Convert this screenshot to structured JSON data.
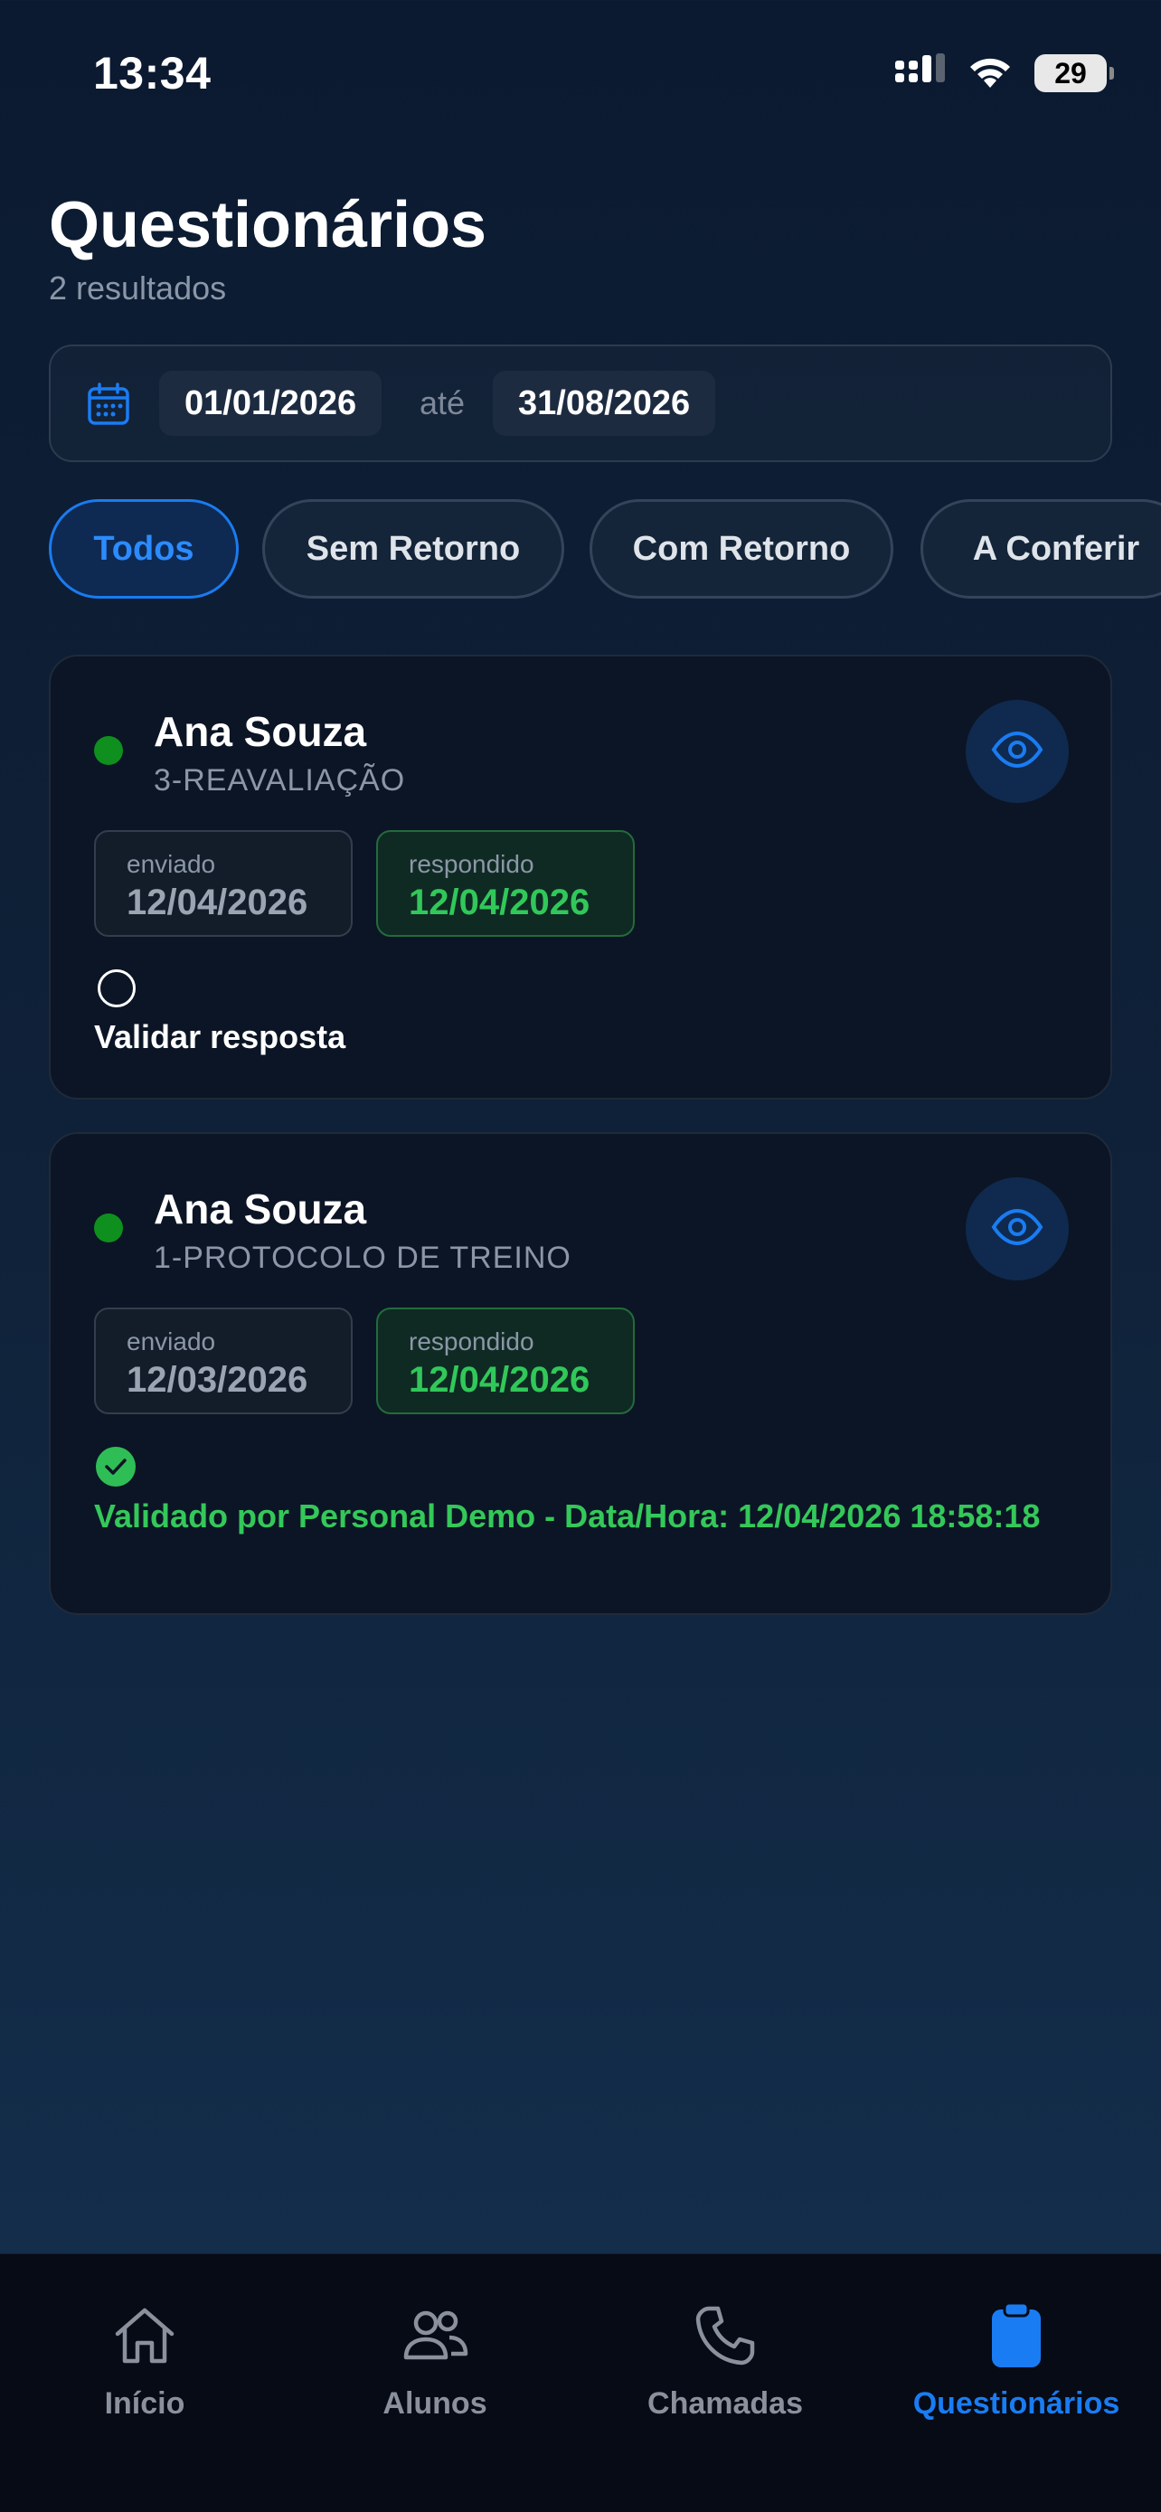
{
  "status_bar": {
    "time": "13:34",
    "battery": "29"
  },
  "header": {
    "title": "Questionários",
    "subtitle": "2 resultados"
  },
  "date_filter": {
    "from": "01/01/2026",
    "separator": "até",
    "to": "31/08/2026"
  },
  "tabs": [
    {
      "label": "Todos",
      "active": true
    },
    {
      "label": "Sem Retorno",
      "active": false
    },
    {
      "label": "Com Retorno",
      "active": false
    },
    {
      "label": "A Conferir",
      "active": false
    }
  ],
  "cards": [
    {
      "name": "Ana Souza",
      "protocol": "3-REAVALIAÇÃO",
      "sent_label": "enviado",
      "sent_date": "12/04/2026",
      "answered_label": "respondido",
      "answered_date": "12/04/2026",
      "validation_text": "Validar resposta",
      "validated": false
    },
    {
      "name": "Ana Souza",
      "protocol": "1-PROTOCOLO DE TREINO",
      "sent_label": "enviado",
      "sent_date": "12/03/2026",
      "answered_label": "respondido",
      "answered_date": "12/04/2026",
      "validation_text": "Validado por Personal Demo - Data/Hora: 12/04/2026 18:58:18",
      "validated": true
    }
  ],
  "bottom_nav": [
    {
      "label": "Início",
      "icon": "home-icon",
      "active": false
    },
    {
      "label": "Alunos",
      "icon": "users-icon",
      "active": false
    },
    {
      "label": "Chamadas",
      "icon": "phone-icon",
      "active": false
    },
    {
      "label": "Questionários",
      "icon": "clipboard-icon",
      "active": true
    }
  ],
  "colors": {
    "accent": "#1a7cf2",
    "success": "#34c85a",
    "status_dot": "#0f8f1e",
    "background": "#0b1a30"
  }
}
